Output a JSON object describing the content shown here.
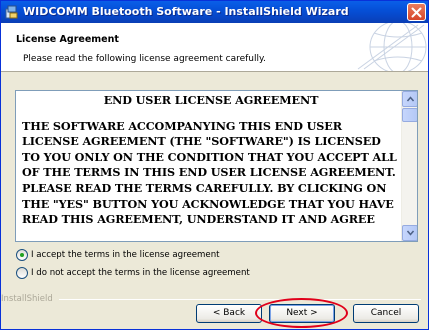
{
  "window": {
    "title": "WIDCOMM Bluetooth Software   - InstallShield Wizard",
    "icon": "installer-icon",
    "close_icon": "close-icon"
  },
  "header": {
    "title": "License Agreement",
    "subtitle": "Please read the following license agreement carefully."
  },
  "license": {
    "heading": "END USER LICENSE AGREEMENT",
    "body": "THE SOFTWARE ACCOMPANYING THIS END USER\nLICENSE AGREEMENT (THE \"SOFTWARE\") IS LICENSED\nTO YOU ONLY ON THE CONDITION THAT YOU ACCEPT ALL\nOF THE TERMS IN THIS END USER LICENSE AGREEMENT.\nPLEASE READ THE TERMS CAREFULLY.  BY CLICKING ON\nTHE \"YES\" BUTTON YOU ACKNOWLEDGE THAT YOU HAVE\nREAD THIS AGREEMENT, UNDERSTAND IT AND AGREE"
  },
  "options": {
    "accept": {
      "label": "I accept the terms in the license agreement",
      "selected": true
    },
    "decline": {
      "label": "I do not accept the terms in the license agreement",
      "selected": false
    }
  },
  "footer": {
    "brand": "InstallShield"
  },
  "buttons": {
    "back": "< Back",
    "next": "Next >",
    "cancel": "Cancel"
  },
  "colors": {
    "titlebar": "#0550d8",
    "highlight": "#e0001a"
  }
}
